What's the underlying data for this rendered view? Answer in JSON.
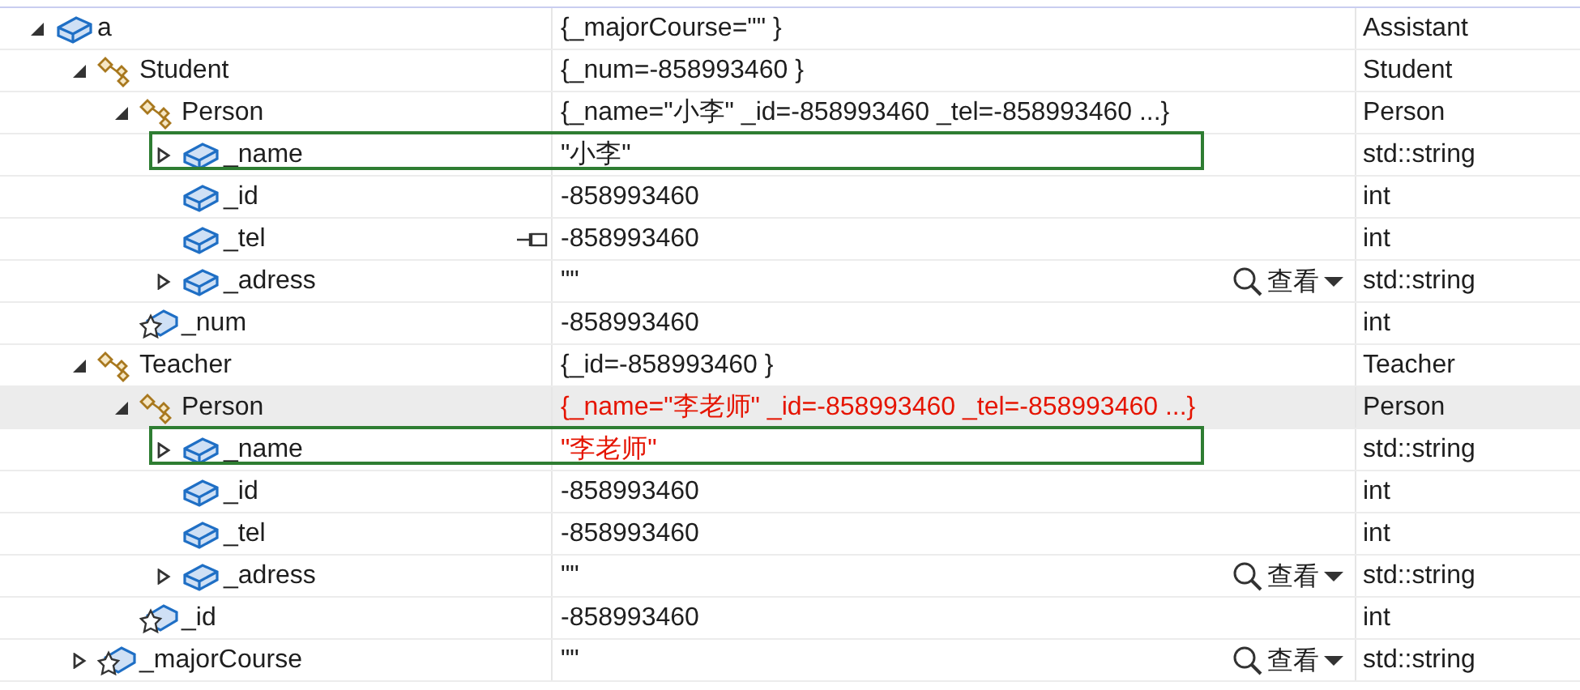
{
  "rows": [
    {
      "name": "a",
      "kind": "field",
      "expanded": true,
      "value": "{_majorCourse=\"\" }",
      "changed": false,
      "type": "Assistant",
      "selected": false,
      "outlined": false,
      "pinned": false,
      "children": [
        {
          "name": "Student",
          "kind": "base",
          "expanded": true,
          "value": "{_num=-858993460 }",
          "changed": false,
          "type": "Student",
          "selected": false,
          "outlined": false,
          "pinned": false,
          "children": [
            {
              "name": "Person",
              "kind": "base",
              "expanded": true,
              "value": "{_name=\"小李\" _id=-858993460 _tel=-858993460 ...}",
              "changed": false,
              "type": "Person",
              "selected": false,
              "outlined": false,
              "pinned": false,
              "children": [
                {
                  "name": "_name",
                  "kind": "field",
                  "expanded": false,
                  "value": "\"小李\"",
                  "changed": false,
                  "type": "std::string",
                  "selected": false,
                  "outlined": true,
                  "pinned": false
                },
                {
                  "name": "_id",
                  "kind": "field",
                  "value": "-858993460",
                  "changed": false,
                  "type": "int",
                  "selected": false,
                  "outlined": false,
                  "pinned": false
                },
                {
                  "name": "_tel",
                  "kind": "field",
                  "value": "-858993460",
                  "changed": false,
                  "type": "int",
                  "selected": false,
                  "outlined": false,
                  "pinned": true
                },
                {
                  "name": "_adress",
                  "kind": "field",
                  "expanded": false,
                  "value": "\"\"",
                  "changed": false,
                  "type": "std::string",
                  "selected": false,
                  "outlined": false,
                  "pinned": false,
                  "view": "查看"
                }
              ]
            },
            {
              "name": "_num",
              "kind": "static",
              "value": "-858993460",
              "changed": false,
              "type": "int",
              "selected": false,
              "outlined": false,
              "pinned": false
            }
          ]
        },
        {
          "name": "Teacher",
          "kind": "base",
          "expanded": true,
          "value": "{_id=-858993460 }",
          "changed": false,
          "type": "Teacher",
          "selected": false,
          "outlined": false,
          "pinned": false,
          "children": [
            {
              "name": "Person",
              "kind": "base",
              "expanded": true,
              "value": "{_name=\"李老师\" _id=-858993460 _tel=-858993460 ...}",
              "changed": true,
              "type": "Person",
              "selected": true,
              "outlined": false,
              "pinned": false,
              "children": [
                {
                  "name": "_name",
                  "kind": "field",
                  "expanded": false,
                  "value": "\"李老师\"",
                  "changed": true,
                  "type": "std::string",
                  "selected": false,
                  "outlined": true,
                  "pinned": false
                },
                {
                  "name": "_id",
                  "kind": "field",
                  "value": "-858993460",
                  "changed": false,
                  "type": "int",
                  "selected": false,
                  "outlined": false,
                  "pinned": false
                },
                {
                  "name": "_tel",
                  "kind": "field",
                  "value": "-858993460",
                  "changed": false,
                  "type": "int",
                  "selected": false,
                  "outlined": false,
                  "pinned": false
                },
                {
                  "name": "_adress",
                  "kind": "field",
                  "expanded": false,
                  "value": "\"\"",
                  "changed": false,
                  "type": "std::string",
                  "selected": false,
                  "outlined": false,
                  "pinned": false,
                  "view": "查看"
                }
              ]
            },
            {
              "name": "_id",
              "kind": "static",
              "value": "-858993460",
              "changed": false,
              "type": "int",
              "selected": false,
              "outlined": false,
              "pinned": false
            }
          ]
        },
        {
          "name": "_majorCourse",
          "kind": "static",
          "expanded": false,
          "value": "\"\"",
          "changed": false,
          "type": "std::string",
          "selected": false,
          "outlined": false,
          "pinned": false,
          "view": "查看"
        }
      ]
    }
  ]
}
